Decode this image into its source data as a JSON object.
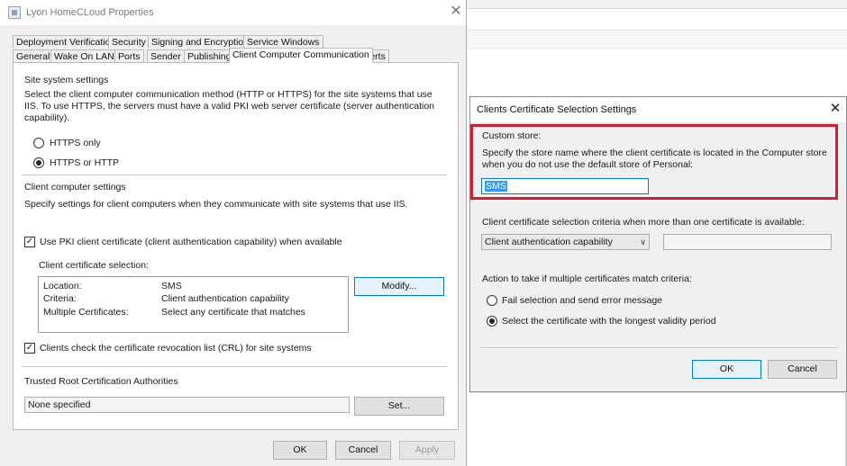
{
  "main_window": {
    "title": "Lyon HomeCLoud Properties",
    "close_glyph": "✕",
    "tabs_row1": [
      "Deployment Verification",
      "Security",
      "Signing and Encryption",
      "Service Windows"
    ],
    "tabs_row2": [
      "General",
      "Wake On LAN",
      "Ports",
      "Sender",
      "Publishing",
      "Client Computer Communication",
      "Alerts"
    ],
    "active_tab": "Client Computer Communication",
    "site_system": {
      "heading": "Site system settings",
      "desc": "Select the client computer communication method (HTTP or HTTPS) for the site systems that use IIS. To use HTTPS, the servers must have a valid PKI web server certificate (server authentication capability).",
      "radio_https_only": "HTTPS only",
      "radio_https_or_http": "HTTPS or HTTP",
      "selected": "HTTPS or HTTP"
    },
    "client_computer": {
      "heading": "Client computer settings",
      "desc": "Specify settings for client computers when they communicate with site systems that use IIS.",
      "use_pki_label": "Use PKI client certificate (client authentication capability) when available",
      "use_pki_checked": true,
      "cert_selection_label": "Client certificate selection:",
      "cert_rows": [
        {
          "key": "Location:",
          "value": "SMS"
        },
        {
          "key": "Criteria:",
          "value": "Client authentication capability"
        },
        {
          "key": "Multiple Certificates:",
          "value": "Select any certificate that matches"
        }
      ],
      "modify_button": "Modify...",
      "crl_label": "Clients check the certificate revocation list (CRL) for site systems",
      "crl_checked": true
    },
    "trusted_root": {
      "heading": "Trusted Root Certification Authorities",
      "value": "None specified",
      "set_button": "Set..."
    },
    "footer": {
      "ok": "OK",
      "cancel": "Cancel",
      "apply": "Apply"
    }
  },
  "dialog": {
    "title": "Clients Certificate Selection Settings",
    "close_glyph": "✕",
    "custom_store_heading": "Custom store:",
    "custom_store_desc": "Specify the store name where the client certificate is located in the Computer store when you do not use the default store of Personal:",
    "custom_store_value": "SMS",
    "criteria_label": "Client certificate selection criteria when more than one certificate is available:",
    "criteria_selected": "Client authentication capability",
    "criteria_text_value": "",
    "multi_match_label": "Action to take if multiple certificates match criteria:",
    "radio_fail": "Fail selection and send error message",
    "radio_longest": "Select the certificate with the longest validity period",
    "selected_action": "Select the certificate with the longest validity period",
    "ok": "OK",
    "cancel": "Cancel"
  },
  "colors": {
    "highlight_box": "#d0202f",
    "selection": "#3399ff",
    "focus_border": "#0078d7"
  }
}
